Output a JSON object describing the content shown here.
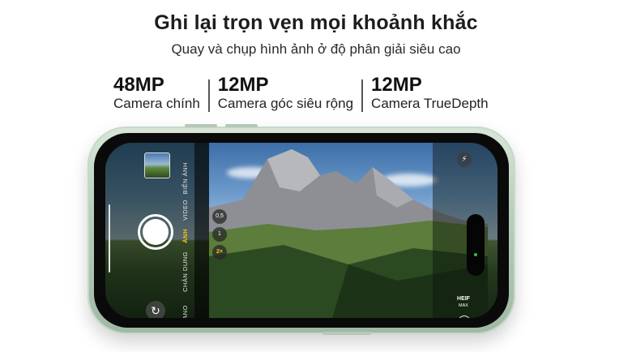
{
  "headline": "Ghi lại trọn vẹn mọi khoảnh khắc",
  "subheadline": "Quay và chụp hình ảnh ở độ phân giải siêu cao",
  "specs": [
    {
      "value": "48MP",
      "label": "Camera chính"
    },
    {
      "value": "12MP",
      "label": "Camera góc siêu rộng"
    },
    {
      "value": "12MP",
      "label": "Camera TrueDepth"
    }
  ],
  "camera_ui": {
    "modes": [
      "BIỂN ẢNH",
      "VIDEO",
      "ẢNH",
      "CHÂN DUNG",
      "PANO"
    ],
    "active_mode": "ẢNH",
    "zoom_levels": [
      "0,5",
      "1",
      "2×"
    ],
    "active_zoom": "2×",
    "format_label": "HEIF",
    "format_sub": "MAX",
    "flip_glyph": "↻",
    "flash_glyph": "⚡",
    "chevron_glyph": "›"
  },
  "colors": {
    "phone_frame": "#b9cfbd",
    "active_accent": "#f5c518",
    "headline_text": "#1d1d1f"
  }
}
